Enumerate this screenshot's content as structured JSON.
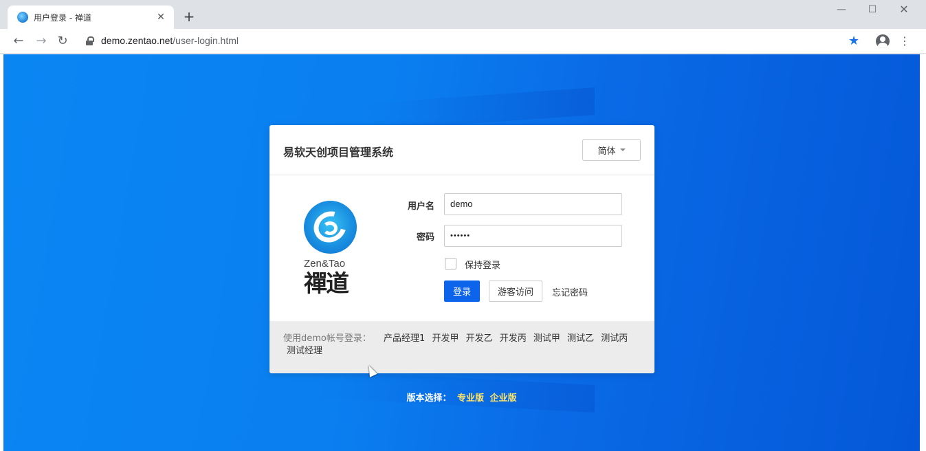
{
  "browser": {
    "tab_title": "用户登录 - 禅道",
    "tab_close": "✕",
    "new_tab": "+",
    "url_host": "demo.zentao.net",
    "url_path": "/user-login.html",
    "controls": {
      "minimize": "—",
      "maximize": "☐",
      "close": "✕"
    },
    "nav": {
      "back": "←",
      "forward": "→",
      "reload": "↻"
    },
    "star": "★",
    "menu": "⋮"
  },
  "login": {
    "title": "易软天创项目管理系统",
    "language": "简体",
    "logo": {
      "en": "Zen&Tao",
      "cn": "禪道"
    },
    "username_label": "用户名",
    "username_value": "demo",
    "password_label": "密码",
    "password_value": "••••••",
    "remember_label": "保持登录",
    "login_button": "登录",
    "guest_button": "游客访问",
    "forgot_link": "忘记密码"
  },
  "demo_accounts": {
    "prefix": "使用demo帐号登录：",
    "accounts": [
      "产品经理1",
      "开发甲",
      "开发乙",
      "开发丙",
      "测试甲",
      "测试乙",
      "测试丙",
      "测试经理"
    ]
  },
  "version": {
    "label": "版本选择：",
    "links": [
      "专业版",
      "企业版"
    ]
  },
  "colors": {
    "background": "#0a7ff0",
    "primary_button": "#0c64eb",
    "version_link": "#ffe36b"
  }
}
